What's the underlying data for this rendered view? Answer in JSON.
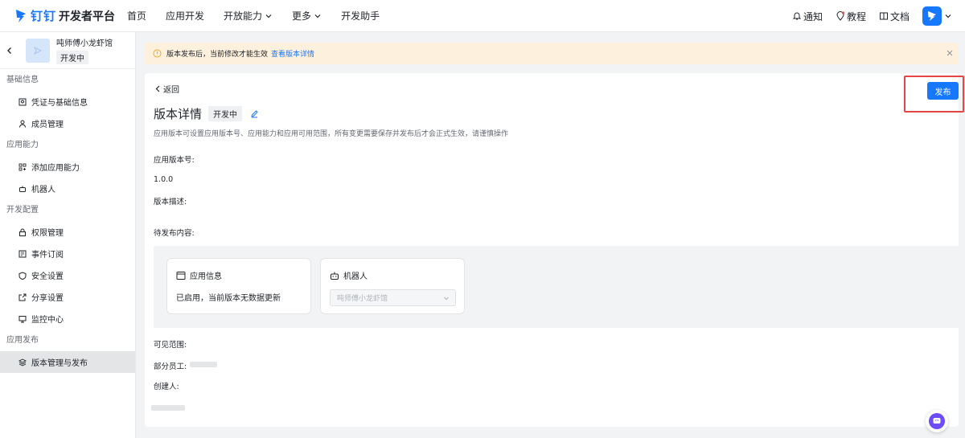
{
  "topnav": {
    "brand": "钉钉",
    "platform": "开发者平台",
    "items": [
      {
        "label": "首页"
      },
      {
        "label": "应用开发"
      },
      {
        "label": "开放能力",
        "dropdown": true
      },
      {
        "label": "更多",
        "dropdown": true
      },
      {
        "label": "开发助手"
      }
    ],
    "tools": {
      "notify": "通知",
      "tutorial": "教程",
      "docs": "文档"
    }
  },
  "sidebar": {
    "app_name": "吨师傅小龙虾馆",
    "app_status": "开发中",
    "groups": [
      {
        "title": "基础信息",
        "items": [
          {
            "label": "凭证与基础信息",
            "icon": "credential-icon"
          },
          {
            "label": "成员管理",
            "icon": "person-icon"
          }
        ]
      },
      {
        "title": "应用能力",
        "items": [
          {
            "label": "添加应用能力",
            "icon": "grid-add-icon"
          },
          {
            "label": "机器人",
            "icon": "robot-icon"
          }
        ]
      },
      {
        "title": "开发配置",
        "items": [
          {
            "label": "权限管理",
            "icon": "lock-icon"
          },
          {
            "label": "事件订阅",
            "icon": "event-icon"
          },
          {
            "label": "安全设置",
            "icon": "shield-icon"
          },
          {
            "label": "分享设置",
            "icon": "share-icon"
          },
          {
            "label": "监控中心",
            "icon": "monitor-icon"
          }
        ]
      },
      {
        "title": "应用发布",
        "items": [
          {
            "label": "版本管理与发布",
            "icon": "layers-icon",
            "active": true
          }
        ]
      }
    ]
  },
  "notice": {
    "text": "版本发布后，当前修改才能生效",
    "link": "查看版本详情"
  },
  "detail": {
    "back": "返回",
    "title": "版本详情",
    "status": "开发中",
    "description": "应用版本可设置应用版本号、应用能力和应用可用范围，所有变更需要保存并发布后才会正式生效，请谨慎操作",
    "publish": "发布",
    "version_label": "应用版本号:",
    "version_value": "1.0.0",
    "desc_label": "版本描述:",
    "pending_label": "待发布内容:",
    "visible_label": "可见范围:",
    "staff_label": "部分员工:",
    "creator_label": "创建人:"
  },
  "cards": {
    "app_info": {
      "title": "应用信息",
      "text": "已启用，当前版本无数据更新"
    },
    "robot": {
      "title": "机器人",
      "select": "吨师傅小龙虾馆"
    }
  },
  "colors": {
    "accent": "#1677ff",
    "notice_bg": "#fdf1dd",
    "highlight": "#e54545"
  }
}
